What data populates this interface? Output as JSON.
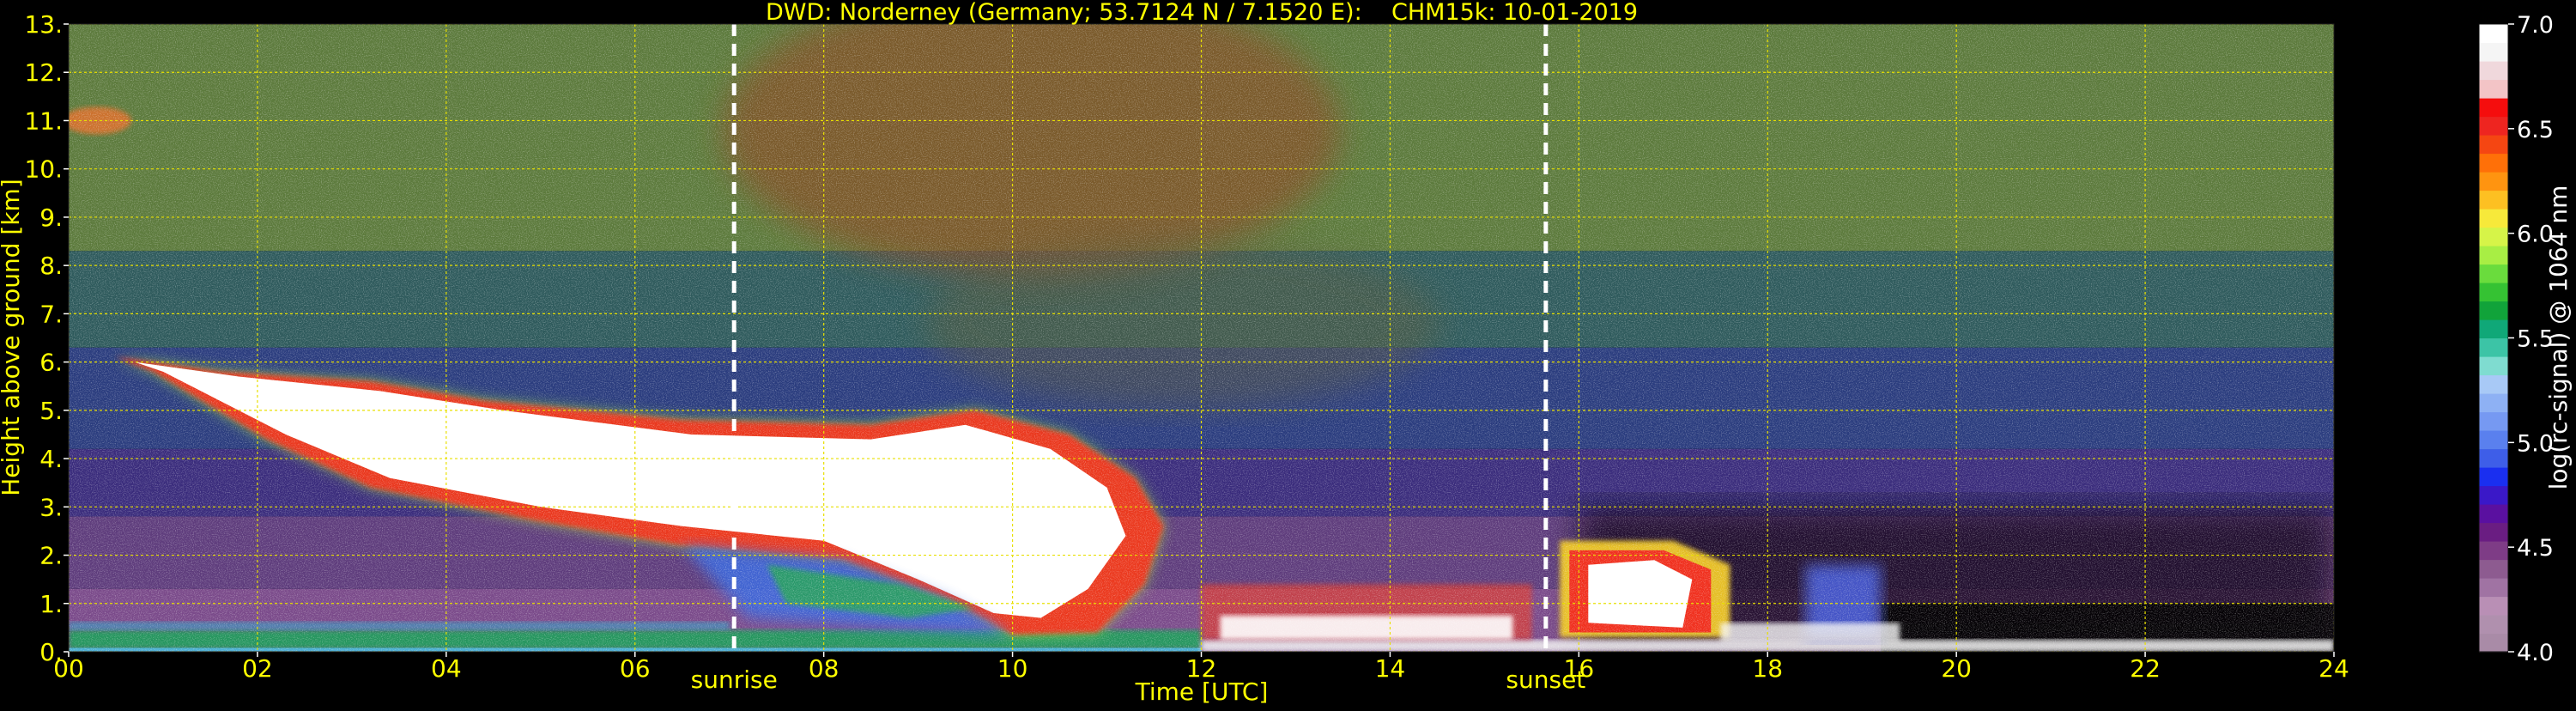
{
  "chart_data": {
    "type": "heatmap",
    "title": "DWD: Norderney (Germany; 53.7124 N / 7.1520 E):    CHM15k: 10-01-2019",
    "xlabel": "Time [UTC]",
    "ylabel": "Height above ground [km]",
    "xlim": [
      0,
      24
    ],
    "ylim": [
      0,
      13
    ],
    "x_ticks": [
      "00",
      "02",
      "04",
      "06",
      "08",
      "10",
      "12",
      "14",
      "16",
      "18",
      "20",
      "22",
      "24"
    ],
    "y_ticks": [
      "0.",
      "1.",
      "2.",
      "3.",
      "4.",
      "5.",
      "6.",
      "7.",
      "8.",
      "9.",
      "10.",
      "11.",
      "12.",
      "13."
    ],
    "grid": true,
    "annotations": [
      {
        "label": "sunrise",
        "x": 7.05
      },
      {
        "label": "sunset",
        "x": 15.65
      }
    ],
    "colorbar": {
      "label": "log(rc-signal) @ 1064 nm",
      "range": [
        4.0,
        7.0
      ],
      "ticks": [
        "4.0",
        "4.5",
        "5.0",
        "5.5",
        "6.0",
        "6.5",
        "7.0"
      ],
      "colors": [
        "#a98ba7",
        "#b090ae",
        "#b98fb5",
        "#a073a3",
        "#8d5b90",
        "#7e3c86",
        "#6a1d82",
        "#5a10a0",
        "#3a18c8",
        "#1a2ff0",
        "#3e5ee8",
        "#5a80ee",
        "#7699f2",
        "#8eb1f4",
        "#a8c9f6",
        "#7fdcd0",
        "#3cc4a6",
        "#10a878",
        "#11a33a",
        "#35c233",
        "#6adc3d",
        "#a8ee44",
        "#d6f448",
        "#f7e93a",
        "#fdc022",
        "#ff9410",
        "#ff7008",
        "#f54612",
        "#ee2520",
        "#f50d0d",
        "#f3c4c6",
        "#f0d8dc",
        "#f5f5f5",
        "#ffffff"
      ]
    }
  }
}
